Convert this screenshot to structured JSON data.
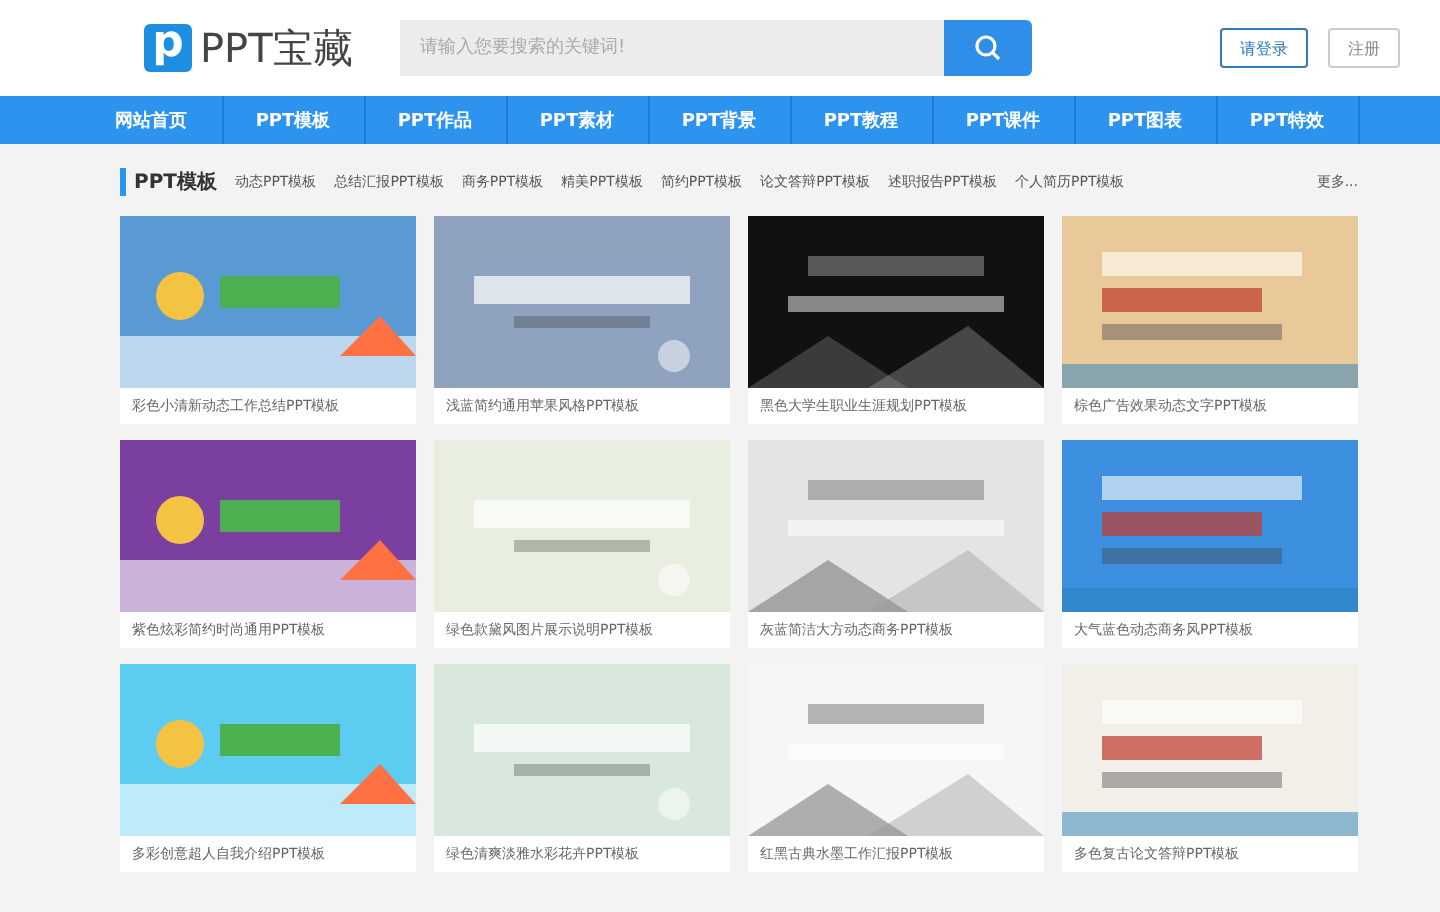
{
  "logo": {
    "mark": "p",
    "name": "PPT宝藏"
  },
  "search": {
    "placeholder": "请输入您要搜索的关键词!"
  },
  "account": [
    "请登录",
    "注册"
  ],
  "nav": [
    {
      "label": "网站首页",
      "selected": false
    },
    {
      "label": "PPT模板",
      "selected": false
    },
    {
      "label": "PPT作品",
      "selected": false
    },
    {
      "label": "PPT素材",
      "selected": false
    },
    {
      "label": "PPT背景",
      "selected": false
    },
    {
      "label": "PPT教程",
      "selected": false
    },
    {
      "label": "PPT课件",
      "selected": false
    },
    {
      "label": "PPT图表",
      "selected": false
    },
    {
      "label": "PPT特效",
      "selected": false
    }
  ],
  "section": {
    "title": "PPT模板",
    "tags": [
      "动态PPT模板",
      "总结汇报PPT模板",
      "商务PPT模板",
      "精美PPT模板",
      "简约PPT模板",
      "论文答辩PPT模板",
      "述职报告PPT模板",
      "个人简历PPT模板"
    ],
    "more": "更多..."
  },
  "cards": [
    {
      "caption": "彩色小清新动态工作总结PPT模板",
      "color": "#5b9bd5"
    },
    {
      "caption": "浅蓝简约通用苹果风格PPT模板",
      "color": "#8fa3c0"
    },
    {
      "caption": "黑色大学生职业生涯规划PPT模板",
      "color": "#111111"
    },
    {
      "caption": "棕色广告效果动态文字PPT模板",
      "color": "#e8c99a"
    },
    {
      "caption": "紫色炫彩简约时尚通用PPT模板",
      "color": "#7b3fa0"
    },
    {
      "caption": "绿色款黛风图片展示说明PPT模板",
      "color": "#e8efe0"
    },
    {
      "caption": "灰蓝简洁大方动态商务PPT模板",
      "color": "#e4e4e4"
    },
    {
      "caption": "大气蓝色动态商务风PPT模板",
      "color": "#3d8fe0"
    },
    {
      "caption": "多彩创意超人自我介绍PPT模板",
      "color": "#5ccdf0"
    },
    {
      "caption": "绿色清爽淡雅水彩花卉PPT模板",
      "color": "#d8e8dc"
    },
    {
      "caption": "红黑古典水墨工作汇报PPT模板",
      "color": "#f6f6f6"
    },
    {
      "caption": "多色复古论文答辩PPT模板",
      "color": "#f2efe8"
    }
  ]
}
